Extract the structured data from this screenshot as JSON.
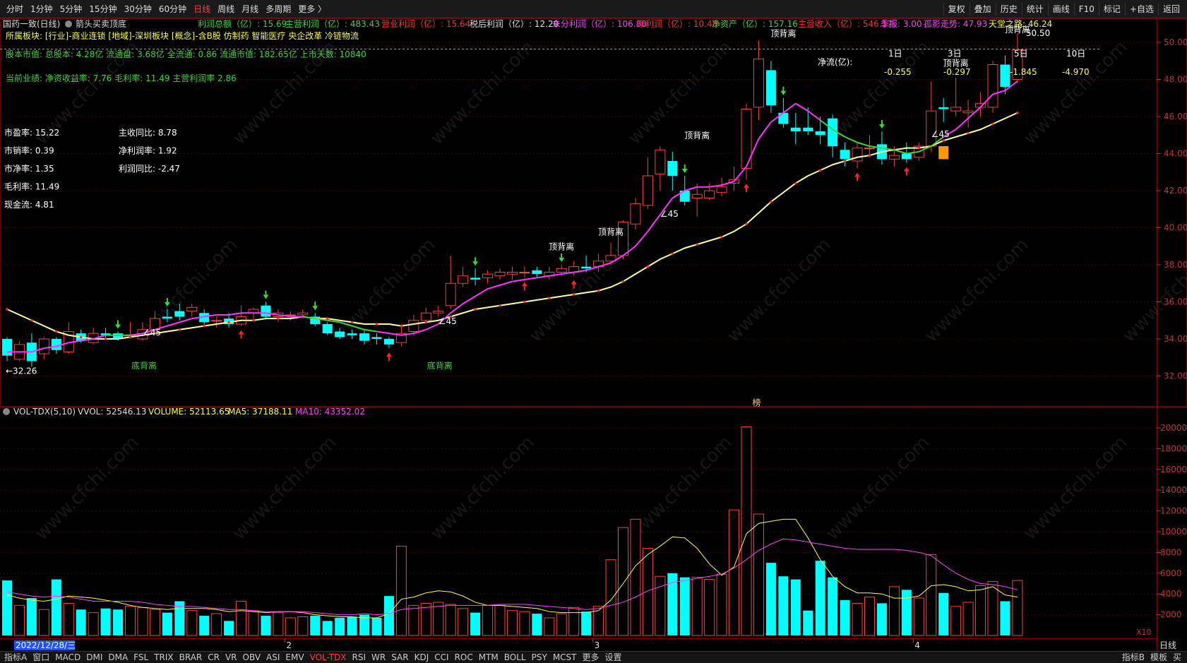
{
  "period_tabs": [
    {
      "label": "分时",
      "active": false
    },
    {
      "label": "1分钟",
      "active": false
    },
    {
      "label": "5分钟",
      "active": false
    },
    {
      "label": "15分钟",
      "active": false
    },
    {
      "label": "30分钟",
      "active": false
    },
    {
      "label": "60分钟",
      "active": false
    },
    {
      "label": "日线",
      "active": true
    },
    {
      "label": "周线",
      "active": false
    },
    {
      "label": "月线",
      "active": false
    },
    {
      "label": "多周期",
      "active": false
    },
    {
      "label": "更多 〉",
      "active": false
    }
  ],
  "top_tools": [
    "复权",
    "叠加",
    "历史",
    "统计",
    "画线",
    "F10",
    "标记",
    "+自选",
    "返回"
  ],
  "info": {
    "stock_name": "国药一致(日线)",
    "formula_name": "箭头买卖顶底",
    "fin_line": [
      {
        "t": "利润总额（亿）: 15.69",
        "c": "#39d839"
      },
      {
        "t": "主营利润（亿）: 483.43",
        "c": "#39d839"
      },
      {
        "t": "营业利润（亿）: 15.64",
        "c": "#ff3030"
      },
      {
        "t": "税后利润（亿）: 12.20",
        "c": "#dddddd"
      },
      {
        "t": "未分利润（亿）: 106.80",
        "c": "#ff40ff"
      },
      {
        "t": "净利润（亿）: 10.48",
        "c": "#ff3030"
      },
      {
        "t": "净资产（亿）: 157.16",
        "c": "#39d839"
      },
      {
        "t": "主营收入（亿）: 546.17",
        "c": "#ff3030"
      },
      {
        "t": "季报: 3.00",
        "c": "#ff40ff"
      },
      {
        "t": "孤影走势: 47.93",
        "c": "#ff40ff"
      },
      {
        "t": "天堂之路: 46.24",
        "c": "#ffff30"
      }
    ],
    "sector_line": "所属板块: [行业]-商业连锁 [地域]-深圳板块 [概念]-含B股 仿制药 智能医疗 央企改革 冷链物流",
    "shares_line": "股本市值: 总股本: 4.28亿 流通盘: 3.68亿 全流通: 0.86 流通市值: 182.65亿 上市天数: 10840",
    "perf_line": "当前业绩:  净资收益率: 7.76 毛利率: 11.49 主营利润率 2.86",
    "ratios_left": [
      "市盈率: 15.22",
      "市销率: 0.39",
      "市净率: 1.35",
      "毛利率: 11.49",
      "现金流: 4.81"
    ],
    "ratios_right": [
      "主收同比: 8.78",
      "净利润率: 1.92",
      "利润同比: -2.47"
    ]
  },
  "annotations": {
    "top_divergence": "顶背离",
    "bottom_divergence": "底背离",
    "angle": "∠45",
    "low_label": "←32.26",
    "high_label": "50.50",
    "bang": "榜",
    "net_flow_title": "净流(亿):",
    "net_flow": [
      {
        "k": "1日",
        "v": "-0.255"
      },
      {
        "k": "3日",
        "v": "-0.297"
      },
      {
        "k": "5日",
        "v": "-1.845"
      },
      {
        "k": "10日",
        "v": "-4.970"
      }
    ]
  },
  "price_axis": [
    "50.00",
    "48.00",
    "46.00",
    "44.00",
    "42.00",
    "40.00",
    "38.00",
    "36.00",
    "34.00",
    "32.00"
  ],
  "vol_axis": [
    "20000",
    "18000",
    "16000",
    "14000",
    "12000",
    "10000",
    "8000",
    "6000",
    "4000",
    "2000"
  ],
  "vol_header": {
    "name": "VOL-TDX(5,10)",
    "vvol": "VVOL: 52546.13",
    "volume": "VOLUME: 52113.65",
    "ma5": "MA5: 37188.11",
    "ma10": "MA10: 43352.02"
  },
  "x10": "X10",
  "date_label": "2022/12/28/三",
  "month_ticks": [
    "2",
    "3",
    "4"
  ],
  "period_label": "日线",
  "ind_tabs": [
    "指标A",
    "窗口",
    "MACD",
    "DMI",
    "DMA",
    "FSL",
    "TRIX",
    "BRAR",
    "CR",
    "VR",
    "OBV",
    "ASI",
    "EMV",
    "VOL-TDX",
    "RSI",
    "WR",
    "SAR",
    "KDJ",
    "CCI",
    "ROC",
    "MTM",
    "BOLL",
    "PSY",
    "MCST",
    "更多",
    "设置"
  ],
  "ind_tab_active": "VOL-TDX",
  "bottom_right": [
    "指标B",
    "模板",
    "买"
  ],
  "colors": {
    "up": "#ff3c3c",
    "down": "#00ffff",
    "ma_short": "#ff33ff",
    "ma_trend": "#ffff99",
    "grid": "#6a0000",
    "axis_text": "#c83232"
  },
  "candles": [
    [
      34.0,
      33.1,
      34.1,
      32.8
    ],
    [
      32.9,
      33.7,
      33.9,
      32.8
    ],
    [
      33.8,
      32.8,
      34.3,
      32.5
    ],
    [
      33.2,
      34.0,
      34.1,
      32.9
    ],
    [
      34.0,
      33.4,
      34.1,
      33.2
    ],
    [
      33.3,
      34.4,
      34.9,
      33.2
    ],
    [
      34.3,
      33.9,
      34.5,
      33.8
    ],
    [
      33.8,
      34.3,
      34.6,
      33.7
    ],
    [
      34.3,
      34.2,
      34.6,
      34.0
    ],
    [
      34.3,
      34.0,
      34.4,
      33.9
    ],
    [
      34.2,
      34.2,
      34.9,
      34.0
    ],
    [
      34.0,
      34.5,
      34.9,
      33.9
    ],
    [
      34.5,
      35.1,
      35.5,
      34.3
    ],
    [
      35.2,
      35.1,
      35.6,
      34.9
    ],
    [
      35.5,
      35.2,
      35.9,
      35.0
    ],
    [
      35.5,
      35.7,
      35.9,
      35.2
    ],
    [
      35.4,
      34.9,
      35.6,
      34.7
    ],
    [
      35.0,
      35.0,
      35.2,
      34.6
    ],
    [
      35.1,
      34.8,
      35.4,
      34.6
    ],
    [
      34.8,
      35.2,
      35.8,
      34.7
    ],
    [
      35.4,
      35.6,
      35.7,
      35.1
    ],
    [
      35.8,
      35.2,
      36.0,
      35.1
    ],
    [
      35.2,
      35.4,
      35.6,
      34.9
    ],
    [
      35.3,
      35.3,
      35.5,
      35.0
    ],
    [
      35.3,
      35.4,
      35.6,
      35.1
    ],
    [
      35.2,
      34.8,
      35.4,
      34.7
    ],
    [
      34.8,
      34.3,
      34.9,
      34.2
    ],
    [
      34.4,
      34.1,
      34.6,
      34.0
    ],
    [
      34.3,
      34.2,
      34.5,
      34.0
    ],
    [
      34.3,
      33.9,
      34.5,
      33.7
    ],
    [
      34.1,
      34.0,
      34.3,
      33.7
    ],
    [
      34.0,
      33.7,
      34.1,
      33.5
    ],
    [
      33.8,
      34.3,
      34.8,
      33.6
    ],
    [
      34.4,
      35.0,
      35.3,
      34.2
    ],
    [
      35.0,
      35.4,
      35.7,
      34.9
    ],
    [
      35.4,
      35.5,
      35.8,
      35.2
    ],
    [
      35.8,
      37.0,
      38.5,
      35.6
    ],
    [
      37.0,
      37.4,
      37.9,
      36.8
    ],
    [
      37.3,
      37.2,
      37.8,
      36.9
    ],
    [
      37.3,
      37.5,
      37.7,
      37.0
    ],
    [
      37.4,
      37.6,
      37.8,
      37.2
    ],
    [
      37.5,
      37.6,
      37.9,
      37.2
    ],
    [
      37.6,
      37.6,
      37.9,
      37.3
    ],
    [
      37.7,
      37.5,
      37.9,
      37.3
    ],
    [
      37.4,
      37.6,
      37.9,
      37.2
    ],
    [
      37.6,
      37.8,
      38.0,
      37.4
    ],
    [
      37.6,
      37.9,
      38.2,
      37.4
    ],
    [
      37.9,
      37.8,
      38.5,
      37.6
    ],
    [
      37.9,
      38.2,
      38.6,
      37.6
    ],
    [
      38.2,
      38.5,
      39.2,
      38.0
    ],
    [
      38.5,
      40.3,
      40.4,
      38.3
    ],
    [
      40.2,
      41.3,
      41.6,
      39.9
    ],
    [
      41.2,
      42.8,
      43.8,
      41.0
    ],
    [
      42.9,
      44.2,
      44.4,
      42.0
    ],
    [
      43.6,
      42.8,
      44.1,
      42.0
    ],
    [
      42.0,
      41.4,
      42.8,
      41.2
    ],
    [
      41.6,
      41.8,
      42.4,
      40.6
    ],
    [
      41.6,
      42.0,
      42.4,
      41.5
    ],
    [
      41.9,
      42.2,
      42.7,
      41.7
    ],
    [
      42.4,
      42.6,
      43.3,
      42.0
    ],
    [
      43.2,
      46.4,
      46.7,
      42.6
    ],
    [
      46.5,
      49.1,
      50.1,
      45.8
    ],
    [
      48.5,
      46.6,
      49.0,
      46.2
    ],
    [
      46.2,
      45.6,
      47.0,
      45.4
    ],
    [
      45.4,
      45.2,
      46.2,
      44.5
    ],
    [
      45.4,
      45.2,
      46.5,
      45.0
    ],
    [
      45.2,
      45.0,
      46.0,
      44.5
    ],
    [
      45.9,
      44.4,
      46.1,
      43.8
    ],
    [
      44.2,
      43.7,
      44.6,
      43.3
    ],
    [
      43.6,
      44.3,
      44.6,
      43.2
    ],
    [
      44.3,
      44.3,
      45.0,
      43.8
    ],
    [
      44.5,
      43.7,
      45.2,
      43.4
    ],
    [
      43.7,
      43.9,
      44.4,
      43.3
    ],
    [
      44.0,
      43.7,
      44.6,
      43.5
    ],
    [
      43.8,
      44.4,
      44.6,
      43.6
    ],
    [
      44.4,
      46.3,
      47.9,
      44.1
    ],
    [
      46.5,
      46.4,
      47.0,
      45.7
    ],
    [
      46.3,
      46.5,
      48.1,
      46.0
    ],
    [
      46.2,
      46.3,
      46.9,
      45.4
    ],
    [
      46.5,
      46.7,
      47.3,
      46.0
    ],
    [
      46.5,
      48.8,
      49.0,
      46.2
    ],
    [
      48.8,
      47.6,
      49.3,
      47.2
    ],
    [
      48.0,
      49.6,
      50.5,
      47.8
    ]
  ],
  "ma_short": [
    33.3,
    33.3,
    33.3,
    33.5,
    33.6,
    33.8,
    33.9,
    34.0,
    34.2,
    34.2,
    34.2,
    34.3,
    34.5,
    34.7,
    34.9,
    35.1,
    35.2,
    35.3,
    35.3,
    35.4,
    35.4,
    35.4,
    35.3,
    35.2,
    35.2,
    35.1,
    35.0,
    34.9,
    34.7,
    34.5,
    34.4,
    34.3,
    34.2,
    34.3,
    34.5,
    34.8,
    35.4,
    35.9,
    36.3,
    36.7,
    36.9,
    37.1,
    37.2,
    37.3,
    37.4,
    37.5,
    37.6,
    37.7,
    37.9,
    38.1,
    38.5,
    39.0,
    39.8,
    40.7,
    41.6,
    42.0,
    42.2,
    42.2,
    42.3,
    42.5,
    43.3,
    44.8,
    45.7,
    46.2,
    46.7,
    46.3,
    45.8,
    45.3,
    44.9,
    44.6,
    44.4,
    44.3,
    44.2,
    44.0,
    44.1,
    44.4,
    44.9,
    45.3,
    45.9,
    46.5,
    47.2,
    47.4,
    47.9
  ],
  "ma_trend": [
    35.6,
    35.3,
    35.0,
    34.7,
    34.4,
    34.2,
    34.1,
    34.0,
    34.0,
    34.0,
    34.1,
    34.2,
    34.3,
    34.4,
    34.5,
    34.6,
    34.7,
    34.8,
    34.9,
    35.0,
    35.0,
    35.1,
    35.1,
    35.1,
    35.2,
    35.1,
    35.1,
    35.0,
    34.9,
    34.8,
    34.8,
    34.8,
    34.7,
    34.8,
    34.9,
    35.0,
    35.2,
    35.4,
    35.6,
    35.7,
    35.8,
    35.9,
    36.0,
    36.1,
    36.2,
    36.3,
    36.4,
    36.5,
    36.6,
    36.8,
    37.1,
    37.5,
    37.9,
    38.3,
    38.6,
    38.9,
    39.1,
    39.3,
    39.5,
    39.8,
    40.2,
    40.8,
    41.4,
    41.9,
    42.4,
    42.8,
    43.1,
    43.4,
    43.6,
    43.8,
    43.9,
    44.1,
    44.2,
    44.3,
    44.3,
    44.4,
    44.7,
    44.9,
    45.1,
    45.3,
    45.6,
    45.9,
    46.2
  ],
  "volumes": [
    5300,
    2900,
    3600,
    2500,
    5400,
    3100,
    2500,
    2200,
    2600,
    2500,
    2800,
    2700,
    2500,
    2200,
    3300,
    2400,
    1900,
    2100,
    1400,
    3300,
    2400,
    1900,
    2200,
    1700,
    1800,
    1900,
    1400,
    1700,
    1800,
    2000,
    1700,
    3800,
    8600,
    2900,
    3100,
    3200,
    3000,
    2600,
    2200,
    2900,
    2900,
    2400,
    2300,
    2100,
    1700,
    2100,
    2700,
    2300,
    2800,
    7300,
    10400,
    11200,
    8400,
    5700,
    6000,
    5600,
    5600,
    5400,
    5900,
    12100,
    20100,
    11700,
    7000,
    5700,
    5400,
    2400,
    7200,
    5600,
    3400,
    3100,
    3700,
    3100,
    4700,
    4400,
    3600,
    7800,
    4100,
    2800,
    3200,
    4800,
    5200,
    3300,
    5300
  ],
  "vol_ma5": [
    3900,
    3600,
    3400,
    3300,
    3500,
    3800,
    3700,
    3600,
    3400,
    3200,
    2900,
    2700,
    2600,
    2500,
    2600,
    2600,
    2600,
    2500,
    2300,
    2400,
    2300,
    2200,
    2300,
    2300,
    2200,
    2000,
    1900,
    1800,
    1800,
    1700,
    1700,
    2100,
    3500,
    3700,
    4100,
    4300,
    4200,
    3800,
    3200,
    2900,
    2900,
    2800,
    2700,
    2600,
    2300,
    2200,
    2200,
    2200,
    2400,
    3400,
    5000,
    6700,
    7800,
    8600,
    9500,
    9400,
    8400,
    6900,
    5800,
    6600,
    9800,
    10800,
    11000,
    11200,
    11200,
    9400,
    7300,
    5700,
    4700,
    4100,
    4100,
    4000,
    3600,
    3600,
    3800,
    4800,
    4900,
    4700,
    4300,
    4400,
    4700,
    3900,
    3700
  ],
  "vol_ma10": [
    4200,
    4000,
    3800,
    3700,
    3800,
    3700,
    3500,
    3300,
    3300,
    3300,
    3300,
    3200,
    3000,
    2900,
    2800,
    2800,
    2700,
    2600,
    2500,
    2500,
    2400,
    2300,
    2300,
    2300,
    2300,
    2200,
    2100,
    2000,
    2000,
    2100,
    2000,
    2100,
    2500,
    2600,
    2700,
    2800,
    2900,
    2900,
    2900,
    2900,
    3000,
    3000,
    3000,
    2900,
    2800,
    2700,
    2600,
    2500,
    2600,
    2900,
    3200,
    3700,
    4300,
    4700,
    5100,
    5300,
    5500,
    5700,
    5900,
    6500,
    7300,
    8200,
    8800,
    9300,
    9200,
    9000,
    8800,
    8600,
    8400,
    8300,
    8300,
    8300,
    8300,
    8200,
    8000,
    7700,
    6800,
    6000,
    5400,
    5000,
    4900,
    4700,
    4400
  ]
}
